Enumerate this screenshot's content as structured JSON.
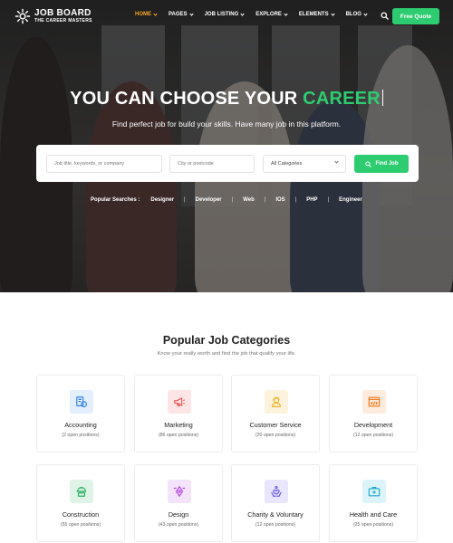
{
  "header": {
    "logo_title": "JOB BOARD",
    "logo_subtitle": "THE CAREER MASTERS",
    "menu": [
      {
        "label": "HOME",
        "active": true
      },
      {
        "label": "PAGES",
        "active": false
      },
      {
        "label": "JOB LISTING",
        "active": false
      },
      {
        "label": "EXPLORE",
        "active": false
      },
      {
        "label": "ELEMENTS",
        "active": false
      },
      {
        "label": "BLOG",
        "active": false
      }
    ],
    "cta_label": "Free Quote"
  },
  "hero": {
    "headline_pre": "YOU CAN CHOOSE YOUR ",
    "headline_highlight": "CAREER",
    "subline": "Find perfect job for build your skills. Have many job in this platform.",
    "search": {
      "keyword_placeholder": "Job title, keywords, or company",
      "location_placeholder": "City or postcode",
      "category_value": "All Categories",
      "button_label": "Find Job"
    },
    "popular_label": "Popular Searches :",
    "popular_tags": [
      "Designer",
      "Developer",
      "Web",
      "IOS",
      "PHP",
      "Engineer"
    ]
  },
  "categories": {
    "title": "Popular Job Categories",
    "subtitle": "Know your really worth and find the job that qualify your life.",
    "items": [
      {
        "name": "Accounting",
        "positions": "(2 open positions)",
        "icon": "accounting-icon",
        "color": "#2f80ed",
        "bg": "#e3effd"
      },
      {
        "name": "Marketing",
        "positions": "(86 open positions)",
        "icon": "megaphone-icon",
        "color": "#eb5757",
        "bg": "#fde5e5"
      },
      {
        "name": "Customer Service",
        "positions": "(20 open positions)",
        "icon": "support-icon",
        "color": "#f2b01e",
        "bg": "#fdf3dc"
      },
      {
        "name": "Development",
        "positions": "(12 open positions)",
        "icon": "code-icon",
        "color": "#f2791e",
        "bg": "#fdebdd"
      },
      {
        "name": "Construction",
        "positions": "(55 open positions)",
        "icon": "construction-icon",
        "color": "#27ae60",
        "bg": "#dff3e7"
      },
      {
        "name": "Design",
        "positions": "(43 open positions)",
        "icon": "pen-tool-icon",
        "color": "#b548e0",
        "bg": "#f3e3fb"
      },
      {
        "name": "Charity & Voluntary",
        "positions": "(12 open positions)",
        "icon": "charity-icon",
        "color": "#6b57e6",
        "bg": "#e9e5fc"
      },
      {
        "name": "Health and Care",
        "positions": "(25 open positions)",
        "icon": "medical-kit-icon",
        "color": "#1ea8c9",
        "bg": "#dcf3f9"
      }
    ]
  }
}
